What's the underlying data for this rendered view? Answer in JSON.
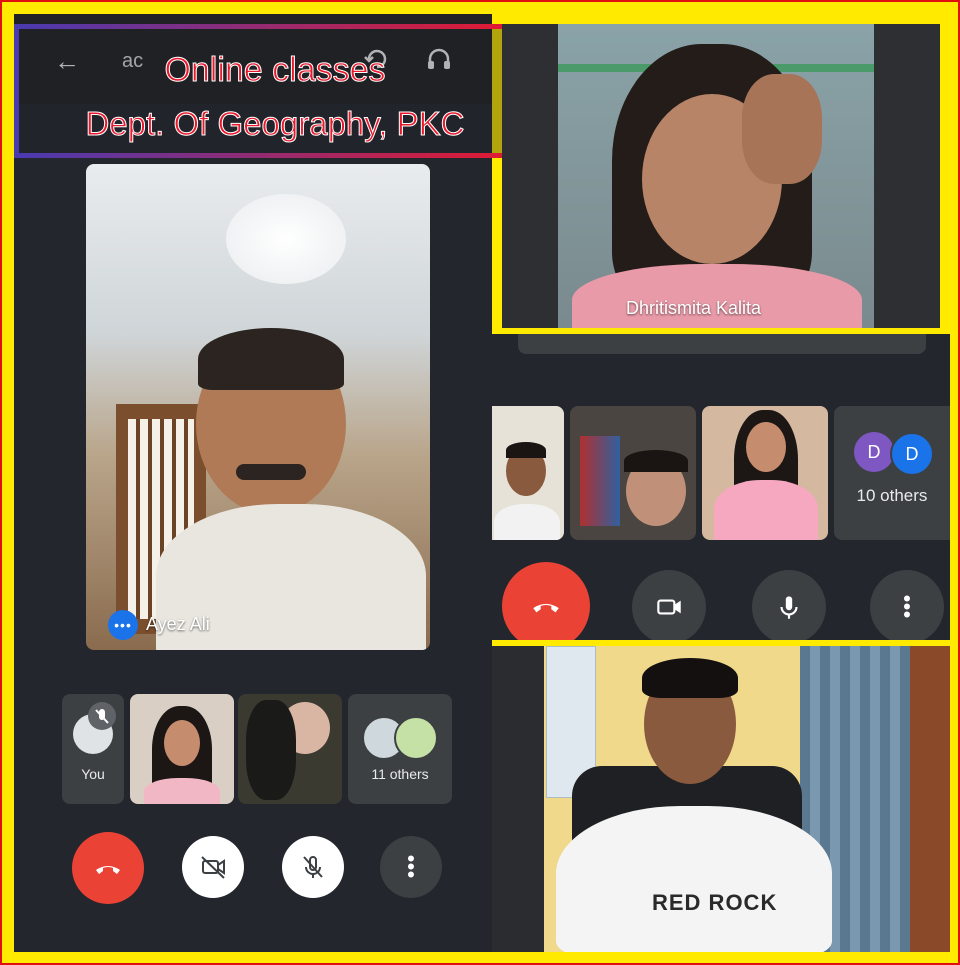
{
  "banner": {
    "line1": "Online classes",
    "line2": "Dept. Of Geography, PKC",
    "text_color": "#e8192c",
    "outline_color": "#ffffff"
  },
  "left_call": {
    "topbar": {
      "back_icon": "arrow-left-icon",
      "meeting_code": "ac",
      "rotate_icon": "rotate-camera-icon",
      "audio_icon": "headphones-icon"
    },
    "main_speaker": "Ayez Ali",
    "speaking_icon": "speaking-dots-icon",
    "thumbnails": [
      {
        "label": "You",
        "muted": true
      },
      {
        "label": ""
      },
      {
        "label": ""
      },
      {
        "label": "11 others"
      }
    ],
    "controls": [
      "hang-up",
      "camera-off",
      "mic-off",
      "more"
    ]
  },
  "top_right": {
    "name": "Dhritismita Kalita"
  },
  "middle_right": {
    "thumbnails": [
      {
        "label": ""
      },
      {
        "label": ""
      },
      {
        "label": ""
      },
      {
        "label": "10 others",
        "avatars": [
          "D",
          "D"
        ]
      }
    ],
    "controls": [
      "hang-up",
      "camera",
      "mic",
      "more"
    ]
  },
  "bottom_right": {
    "shirt_text": "RED ROCK"
  },
  "colors": {
    "frame": "#ffea00",
    "meet_dark": "#23262d",
    "hangup": "#ea4335",
    "avatar_purple": "#7e57c2",
    "avatar_blue": "#1a73e8"
  }
}
